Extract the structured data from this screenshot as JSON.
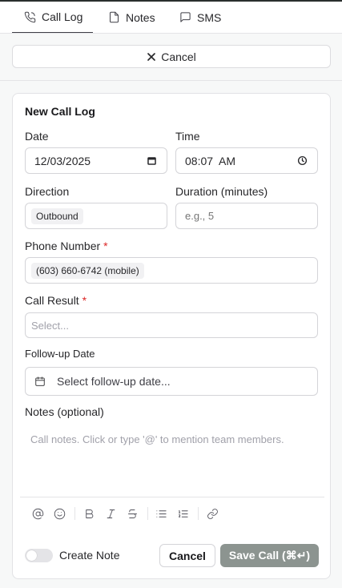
{
  "tabs": [
    {
      "label": "Call Log",
      "icon": "phone-icon",
      "active": true
    },
    {
      "label": "Notes",
      "icon": "file-icon",
      "active": false
    },
    {
      "label": "SMS",
      "icon": "message-icon",
      "active": false
    }
  ],
  "top_cancel": {
    "label": "Cancel",
    "icon": "x-icon"
  },
  "form": {
    "title": "New Call Log",
    "date": {
      "label": "Date",
      "value": "12/03/2025",
      "icon": "calendar-icon"
    },
    "time": {
      "label": "Time",
      "value": "08:07  AM",
      "icon": "clock-icon"
    },
    "direction": {
      "label": "Direction",
      "value": "Outbound"
    },
    "duration": {
      "label": "Duration (minutes)",
      "placeholder": "e.g., 5"
    },
    "phone": {
      "label": "Phone Number",
      "required_mark": "*",
      "value": "(603) 660-6742 (mobile)"
    },
    "call_result": {
      "label": "Call Result",
      "required_mark": "*",
      "placeholder": "Select..."
    },
    "followup": {
      "label": "Follow-up Date",
      "placeholder": "Select follow-up date...",
      "icon": "calendar-icon"
    },
    "notes": {
      "label": "Notes (optional)",
      "placeholder": "Call notes. Click or type '@' to mention team members."
    }
  },
  "toolbar": [
    "at-icon",
    "emoji-icon",
    "bold-icon",
    "italic-icon",
    "strikethrough-icon",
    "bullet-list-icon",
    "numbered-list-icon",
    "link-icon"
  ],
  "footer": {
    "toggle_label": "Create Note",
    "toggle_on": false,
    "cancel_label": "Cancel",
    "save_label": "Save Call (⌘↵)"
  },
  "colors": {
    "save_button": "#8c9490",
    "required": "#dc2626",
    "page_bg": "#f7f8f8"
  }
}
